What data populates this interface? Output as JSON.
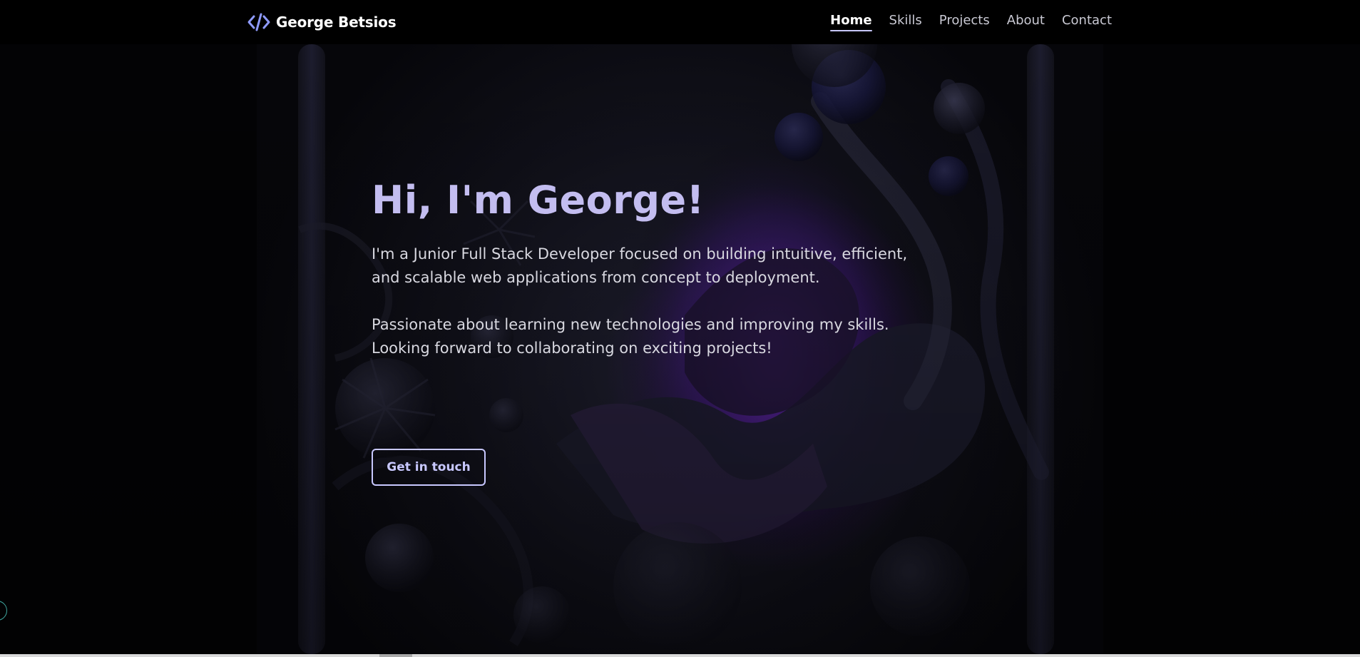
{
  "brand": {
    "icon": "code-brackets-icon",
    "name": "George Betsios",
    "accent_color": "#8f9bff"
  },
  "nav": {
    "active": "Home",
    "items": [
      {
        "label": "Home"
      },
      {
        "label": "Skills"
      },
      {
        "label": "Projects"
      },
      {
        "label": "About"
      },
      {
        "label": "Contact"
      }
    ]
  },
  "hero": {
    "title": "Hi, I'm George!",
    "paragraph_1": "I'm a Junior Full Stack Developer focused on building intuitive, efficient, and scalable web applications from concept to deployment.",
    "paragraph_2": "Passionate about learning new technologies and improving my skills. Looking forward to collaborating on exciting projects!",
    "cta_label": "Get in touch",
    "title_color": "#c3bdf0",
    "cta_color": "#c8c8ff"
  }
}
